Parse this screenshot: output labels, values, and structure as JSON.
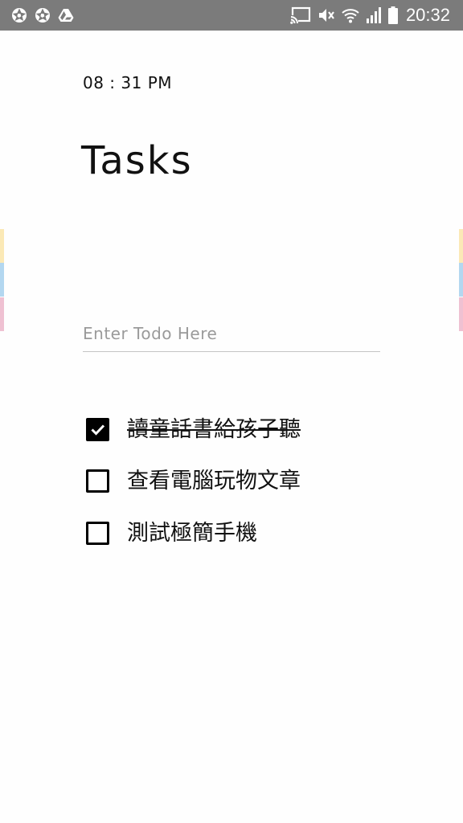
{
  "status_bar": {
    "left_icons": [
      "aperture-icon",
      "aperture-icon",
      "drive-icon"
    ],
    "right_icons": [
      "cast-icon",
      "mute-icon",
      "wifi-icon",
      "signal-icon",
      "battery-icon"
    ],
    "time": "20:32",
    "background": "#7b7b7b"
  },
  "header": {
    "time": "08 : 31 PM",
    "title": "Tasks"
  },
  "input": {
    "placeholder": "Enter Todo Here",
    "value": ""
  },
  "tasks": [
    {
      "label": "讀童話書給孩子聽",
      "checked": true
    },
    {
      "label": "查看電腦玩物文章",
      "checked": false
    },
    {
      "label": "測試極簡手機",
      "checked": false
    }
  ],
  "edge_colors": {
    "yellow": "#fbe9b6",
    "blue": "#b3d7f0",
    "pink": "#efc1d2"
  }
}
